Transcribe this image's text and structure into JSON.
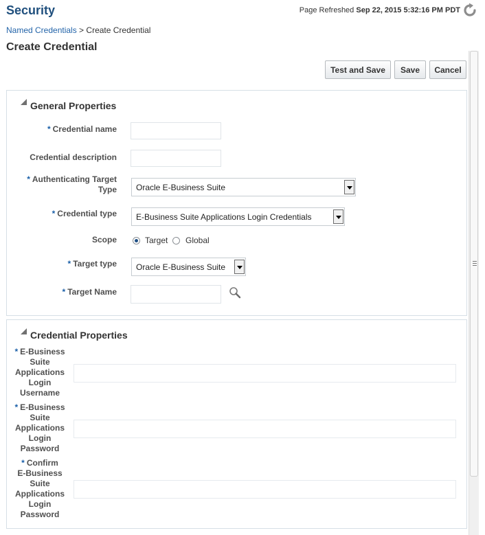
{
  "header": {
    "title": "Security",
    "refresh_label": "Page Refreshed",
    "refresh_time": "Sep 22, 2015 5:32:16 PM PDT",
    "refresh_icon": "refresh-icon"
  },
  "breadcrumb": {
    "parent": "Named Credentials",
    "separator": " > ",
    "current": "Create Credential"
  },
  "page_title": "Create Credential",
  "toolbar": {
    "test_save_label": "Test and Save",
    "save_label": "Save",
    "cancel_label": "Cancel"
  },
  "general": {
    "title": "General Properties",
    "credential_name_label": "Credential name",
    "credential_name_value": "",
    "credential_description_label": "Credential description",
    "credential_description_value": "",
    "auth_target_type_label_1": "Authenticating Target",
    "auth_target_type_label_2": "Type",
    "auth_target_type_value": "Oracle E-Business Suite",
    "credential_type_label": "Credential type",
    "credential_type_value": "E-Business Suite Applications Login Credentials",
    "scope_label": "Scope",
    "scope_options": [
      "Target",
      "Global"
    ],
    "scope_selected": "Target",
    "target_type_label": "Target type",
    "target_type_value": "Oracle E-Business Suite",
    "target_name_label": "Target Name",
    "target_name_value": "",
    "search_icon": "search-icon"
  },
  "credential_props": {
    "title": "Credential Properties",
    "username_label": [
      "E-Business",
      "Suite",
      "Applications",
      "Login",
      "Username"
    ],
    "password_label": [
      "E-Business",
      "Suite",
      "Applications",
      "Login",
      "Password"
    ],
    "confirm_label": [
      "Confirm",
      "E-Business",
      "Suite",
      "Applications",
      "Login",
      "Password"
    ],
    "username_value": "",
    "password_value": "",
    "confirm_value": ""
  },
  "required_mark": "*",
  "colors": {
    "accent": "#1f4f7d",
    "link": "#2364a9",
    "required": "#1a5fa8"
  }
}
